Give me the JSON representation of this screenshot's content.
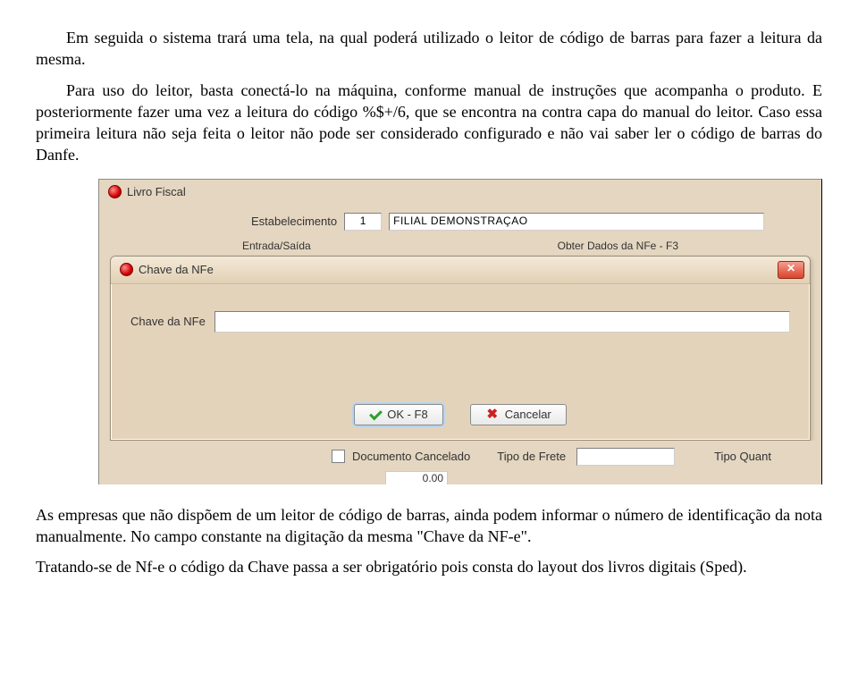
{
  "para1": "Em seguida o sistema trará uma tela, na qual poderá utilizado o leitor de código de barras para fazer a leitura da mesma.",
  "para2": "Para uso do leitor, basta conectá-lo na máquina, conforme manual de instruções que acompanha o produto. E posteriormente fazer uma vez a leitura do código %$+/6, que se encontra na contra capa do manual do leitor. Caso essa primeira leitura não seja feita o leitor não pode ser considerado configurado e não vai saber ler o código de barras do Danfe.",
  "para3": "As empresas que não dispõem de um leitor de código de barras, ainda podem informar o número de identificação da nota manualmente. No campo constante na digitação da mesma \"Chave da NF-e\".",
  "para4": "Tratando-se de Nf-e o código da Chave passa a ser obrigatório pois consta do layout dos livros digitais (Sped).",
  "app": {
    "window_title": "Livro Fiscal",
    "estabelecimento_label": "Estabelecimento",
    "estabelecimento_code": "1",
    "estabelecimento_name": "FILIAL DEMONSTRAÇAO",
    "sep_left": "Entrada/Saída",
    "sep_right": "Obter Dados da NFe - F3",
    "dialog": {
      "title": "Chave da NFe",
      "field_label": "Chave da NFe",
      "ok_label": "OK - F8",
      "cancel_label": "Cancelar"
    },
    "bottom": {
      "doc_cancelado": "Documento Cancelado",
      "tipo_frete": "Tipo de Frete",
      "tipo_quant": "Tipo Quant"
    },
    "footer": {
      "value": "0.00"
    }
  }
}
